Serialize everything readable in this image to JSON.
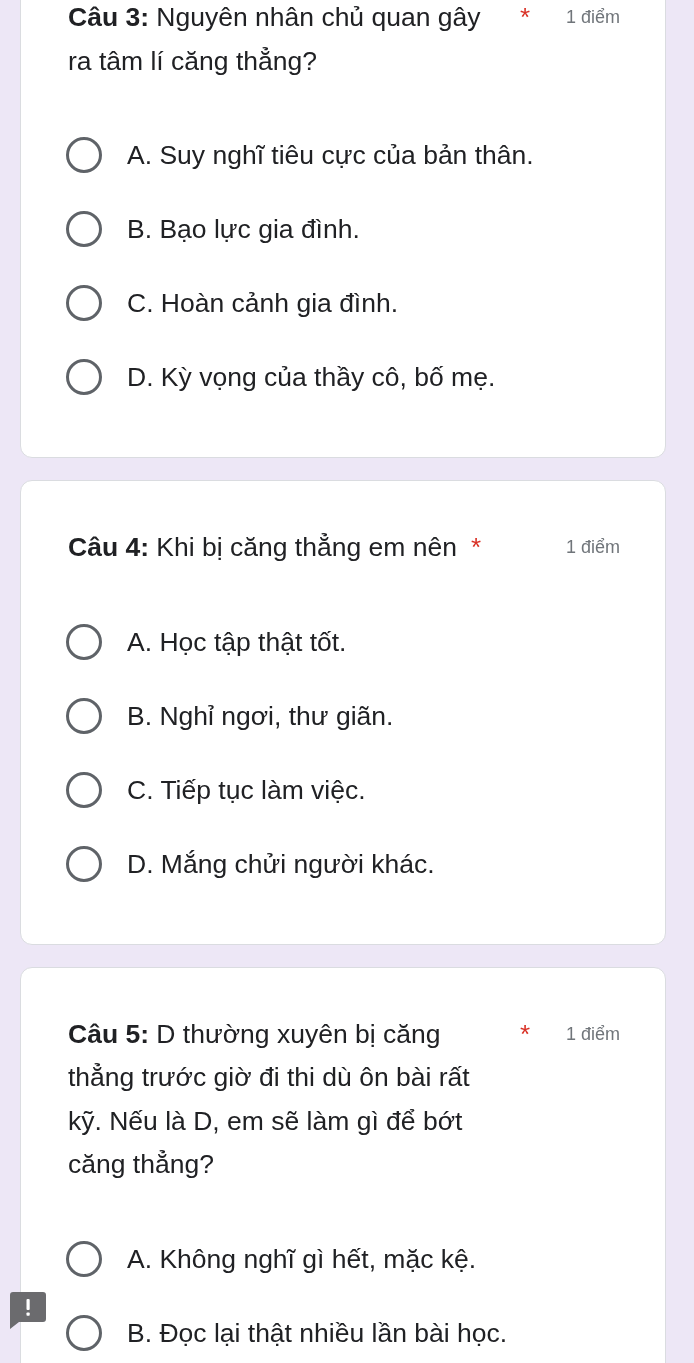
{
  "questions": [
    {
      "title": "**Câu 3:** Nguyên nhân chủ quan gây ra tâm lí căng thẳng?",
      "required_mark": "*",
      "points": "1 điểm",
      "options": [
        {
          "label": "A. Suy nghĩ tiêu cực của bản thân.",
          "selected": false
        },
        {
          "label": "B. Bạo lực gia đình.",
          "selected": false
        },
        {
          "label": "C. Hoàn cảnh gia đình.",
          "selected": false
        },
        {
          "label": "D. Kỳ vọng của thầy cô, bố mẹ.",
          "selected": false
        }
      ]
    },
    {
      "title": "**Câu 4:** Khi bị căng thẳng em nên",
      "required_mark": "*",
      "points": "1 điểm",
      "options": [
        {
          "label": "A. Học tập thật tốt.",
          "selected": false
        },
        {
          "label": "B. Nghỉ ngơi, thư giãn.",
          "selected": false
        },
        {
          "label": "C. Tiếp tục làm việc.",
          "selected": false
        },
        {
          "label": "D. Mắng chửi người khác.",
          "selected": false
        }
      ]
    },
    {
      "title": "**Câu 5:** D thường xuyên bị căng thẳng trước giờ đi thi dù ôn bài rất kỹ. Nếu là D, em sẽ làm gì để bớt căng thẳng?",
      "required_mark": "*",
      "points": "1 điểm",
      "options": [
        {
          "label": "A. Không nghĩ gì hết, mặc kệ.",
          "selected": false
        },
        {
          "label": "B. Đọc lại thật nhiều lần bài học.",
          "selected": false
        }
      ]
    }
  ]
}
